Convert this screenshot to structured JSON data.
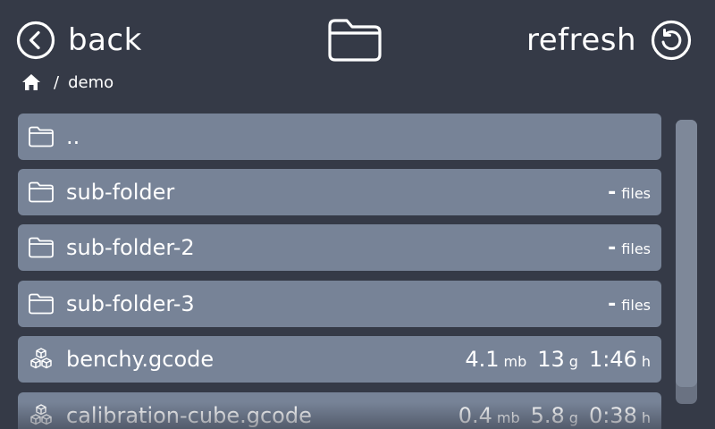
{
  "header": {
    "back_label": "back",
    "refresh_label": "refresh",
    "back_icon": "chevron-left-circle-icon",
    "folder_icon": "folder-icon",
    "refresh_icon": "refresh-circle-icon"
  },
  "breadcrumb": {
    "home_icon": "home-icon",
    "separator": "/",
    "current": "demo"
  },
  "files": [
    {
      "type": "folder",
      "name": "..",
      "dash": "",
      "files_label": ""
    },
    {
      "type": "folder",
      "name": "sub-folder",
      "dash": "-",
      "files_label": "files"
    },
    {
      "type": "folder",
      "name": "sub-folder-2",
      "dash": "-",
      "files_label": "files"
    },
    {
      "type": "folder",
      "name": "sub-folder-3",
      "dash": "-",
      "files_label": "files"
    },
    {
      "type": "gcode",
      "name": "benchy.gcode",
      "size": "4.1",
      "size_unit": "mb",
      "weight": "13",
      "weight_unit": "g",
      "time": "1:46",
      "time_unit": "h"
    },
    {
      "type": "gcode",
      "name": "calibration-cube.gcode",
      "size": "0.4",
      "size_unit": "mb",
      "weight": "5.8",
      "weight_unit": "g",
      "time": "0:38",
      "time_unit": "h"
    }
  ],
  "scroll": {
    "position_fraction": 0.0,
    "visible_fraction": 0.94
  },
  "colors": {
    "background": "#353a47",
    "row": "#778397",
    "text": "#ffffff",
    "scroll_track": "#6a7282"
  }
}
